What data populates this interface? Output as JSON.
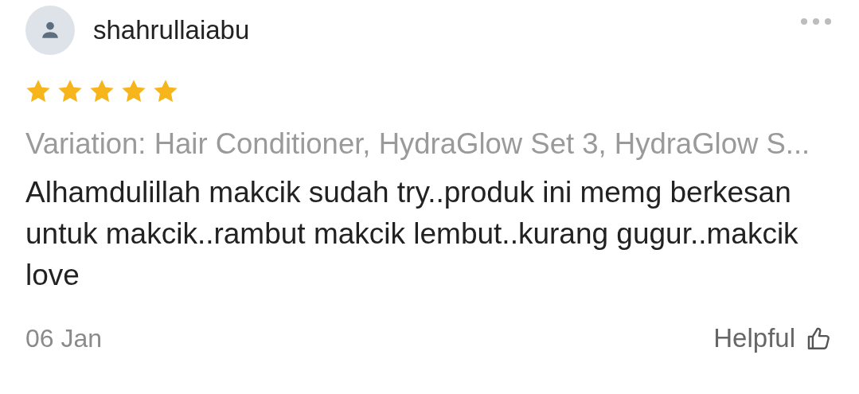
{
  "review": {
    "username": "shahrullaiabu",
    "stars": 5,
    "variation": "Variation: Hair Conditioner, HydraGlow Set 3, HydraGlow S...",
    "text": "Alhamdulillah makcik sudah try..produk ini memg berkesan untuk makcik..rambut makcik lembut..kurang gugur..makcik love",
    "date": "06 Jan",
    "helpful_label": "Helpful"
  }
}
